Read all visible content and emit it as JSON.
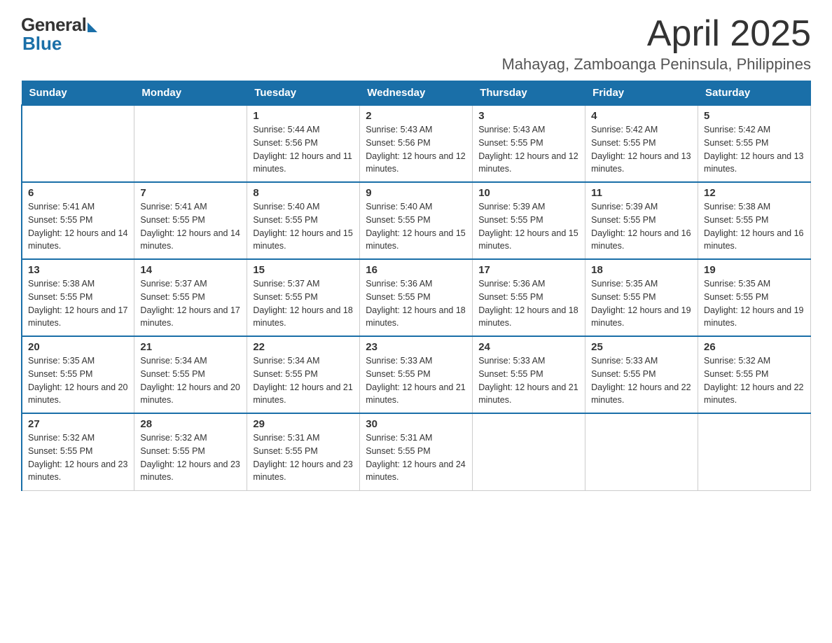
{
  "logo": {
    "general": "General",
    "blue": "Blue"
  },
  "header": {
    "month": "April 2025",
    "location": "Mahayag, Zamboanga Peninsula, Philippines"
  },
  "weekdays": [
    "Sunday",
    "Monday",
    "Tuesday",
    "Wednesday",
    "Thursday",
    "Friday",
    "Saturday"
  ],
  "weeks": [
    [
      {
        "day": "",
        "sunrise": "",
        "sunset": "",
        "daylight": ""
      },
      {
        "day": "",
        "sunrise": "",
        "sunset": "",
        "daylight": ""
      },
      {
        "day": "1",
        "sunrise": "Sunrise: 5:44 AM",
        "sunset": "Sunset: 5:56 PM",
        "daylight": "Daylight: 12 hours and 11 minutes."
      },
      {
        "day": "2",
        "sunrise": "Sunrise: 5:43 AM",
        "sunset": "Sunset: 5:56 PM",
        "daylight": "Daylight: 12 hours and 12 minutes."
      },
      {
        "day": "3",
        "sunrise": "Sunrise: 5:43 AM",
        "sunset": "Sunset: 5:55 PM",
        "daylight": "Daylight: 12 hours and 12 minutes."
      },
      {
        "day": "4",
        "sunrise": "Sunrise: 5:42 AM",
        "sunset": "Sunset: 5:55 PM",
        "daylight": "Daylight: 12 hours and 13 minutes."
      },
      {
        "day": "5",
        "sunrise": "Sunrise: 5:42 AM",
        "sunset": "Sunset: 5:55 PM",
        "daylight": "Daylight: 12 hours and 13 minutes."
      }
    ],
    [
      {
        "day": "6",
        "sunrise": "Sunrise: 5:41 AM",
        "sunset": "Sunset: 5:55 PM",
        "daylight": "Daylight: 12 hours and 14 minutes."
      },
      {
        "day": "7",
        "sunrise": "Sunrise: 5:41 AM",
        "sunset": "Sunset: 5:55 PM",
        "daylight": "Daylight: 12 hours and 14 minutes."
      },
      {
        "day": "8",
        "sunrise": "Sunrise: 5:40 AM",
        "sunset": "Sunset: 5:55 PM",
        "daylight": "Daylight: 12 hours and 15 minutes."
      },
      {
        "day": "9",
        "sunrise": "Sunrise: 5:40 AM",
        "sunset": "Sunset: 5:55 PM",
        "daylight": "Daylight: 12 hours and 15 minutes."
      },
      {
        "day": "10",
        "sunrise": "Sunrise: 5:39 AM",
        "sunset": "Sunset: 5:55 PM",
        "daylight": "Daylight: 12 hours and 15 minutes."
      },
      {
        "day": "11",
        "sunrise": "Sunrise: 5:39 AM",
        "sunset": "Sunset: 5:55 PM",
        "daylight": "Daylight: 12 hours and 16 minutes."
      },
      {
        "day": "12",
        "sunrise": "Sunrise: 5:38 AM",
        "sunset": "Sunset: 5:55 PM",
        "daylight": "Daylight: 12 hours and 16 minutes."
      }
    ],
    [
      {
        "day": "13",
        "sunrise": "Sunrise: 5:38 AM",
        "sunset": "Sunset: 5:55 PM",
        "daylight": "Daylight: 12 hours and 17 minutes."
      },
      {
        "day": "14",
        "sunrise": "Sunrise: 5:37 AM",
        "sunset": "Sunset: 5:55 PM",
        "daylight": "Daylight: 12 hours and 17 minutes."
      },
      {
        "day": "15",
        "sunrise": "Sunrise: 5:37 AM",
        "sunset": "Sunset: 5:55 PM",
        "daylight": "Daylight: 12 hours and 18 minutes."
      },
      {
        "day": "16",
        "sunrise": "Sunrise: 5:36 AM",
        "sunset": "Sunset: 5:55 PM",
        "daylight": "Daylight: 12 hours and 18 minutes."
      },
      {
        "day": "17",
        "sunrise": "Sunrise: 5:36 AM",
        "sunset": "Sunset: 5:55 PM",
        "daylight": "Daylight: 12 hours and 18 minutes."
      },
      {
        "day": "18",
        "sunrise": "Sunrise: 5:35 AM",
        "sunset": "Sunset: 5:55 PM",
        "daylight": "Daylight: 12 hours and 19 minutes."
      },
      {
        "day": "19",
        "sunrise": "Sunrise: 5:35 AM",
        "sunset": "Sunset: 5:55 PM",
        "daylight": "Daylight: 12 hours and 19 minutes."
      }
    ],
    [
      {
        "day": "20",
        "sunrise": "Sunrise: 5:35 AM",
        "sunset": "Sunset: 5:55 PM",
        "daylight": "Daylight: 12 hours and 20 minutes."
      },
      {
        "day": "21",
        "sunrise": "Sunrise: 5:34 AM",
        "sunset": "Sunset: 5:55 PM",
        "daylight": "Daylight: 12 hours and 20 minutes."
      },
      {
        "day": "22",
        "sunrise": "Sunrise: 5:34 AM",
        "sunset": "Sunset: 5:55 PM",
        "daylight": "Daylight: 12 hours and 21 minutes."
      },
      {
        "day": "23",
        "sunrise": "Sunrise: 5:33 AM",
        "sunset": "Sunset: 5:55 PM",
        "daylight": "Daylight: 12 hours and 21 minutes."
      },
      {
        "day": "24",
        "sunrise": "Sunrise: 5:33 AM",
        "sunset": "Sunset: 5:55 PM",
        "daylight": "Daylight: 12 hours and 21 minutes."
      },
      {
        "day": "25",
        "sunrise": "Sunrise: 5:33 AM",
        "sunset": "Sunset: 5:55 PM",
        "daylight": "Daylight: 12 hours and 22 minutes."
      },
      {
        "day": "26",
        "sunrise": "Sunrise: 5:32 AM",
        "sunset": "Sunset: 5:55 PM",
        "daylight": "Daylight: 12 hours and 22 minutes."
      }
    ],
    [
      {
        "day": "27",
        "sunrise": "Sunrise: 5:32 AM",
        "sunset": "Sunset: 5:55 PM",
        "daylight": "Daylight: 12 hours and 23 minutes."
      },
      {
        "day": "28",
        "sunrise": "Sunrise: 5:32 AM",
        "sunset": "Sunset: 5:55 PM",
        "daylight": "Daylight: 12 hours and 23 minutes."
      },
      {
        "day": "29",
        "sunrise": "Sunrise: 5:31 AM",
        "sunset": "Sunset: 5:55 PM",
        "daylight": "Daylight: 12 hours and 23 minutes."
      },
      {
        "day": "30",
        "sunrise": "Sunrise: 5:31 AM",
        "sunset": "Sunset: 5:55 PM",
        "daylight": "Daylight: 12 hours and 24 minutes."
      },
      {
        "day": "",
        "sunrise": "",
        "sunset": "",
        "daylight": ""
      },
      {
        "day": "",
        "sunrise": "",
        "sunset": "",
        "daylight": ""
      },
      {
        "day": "",
        "sunrise": "",
        "sunset": "",
        "daylight": ""
      }
    ]
  ]
}
